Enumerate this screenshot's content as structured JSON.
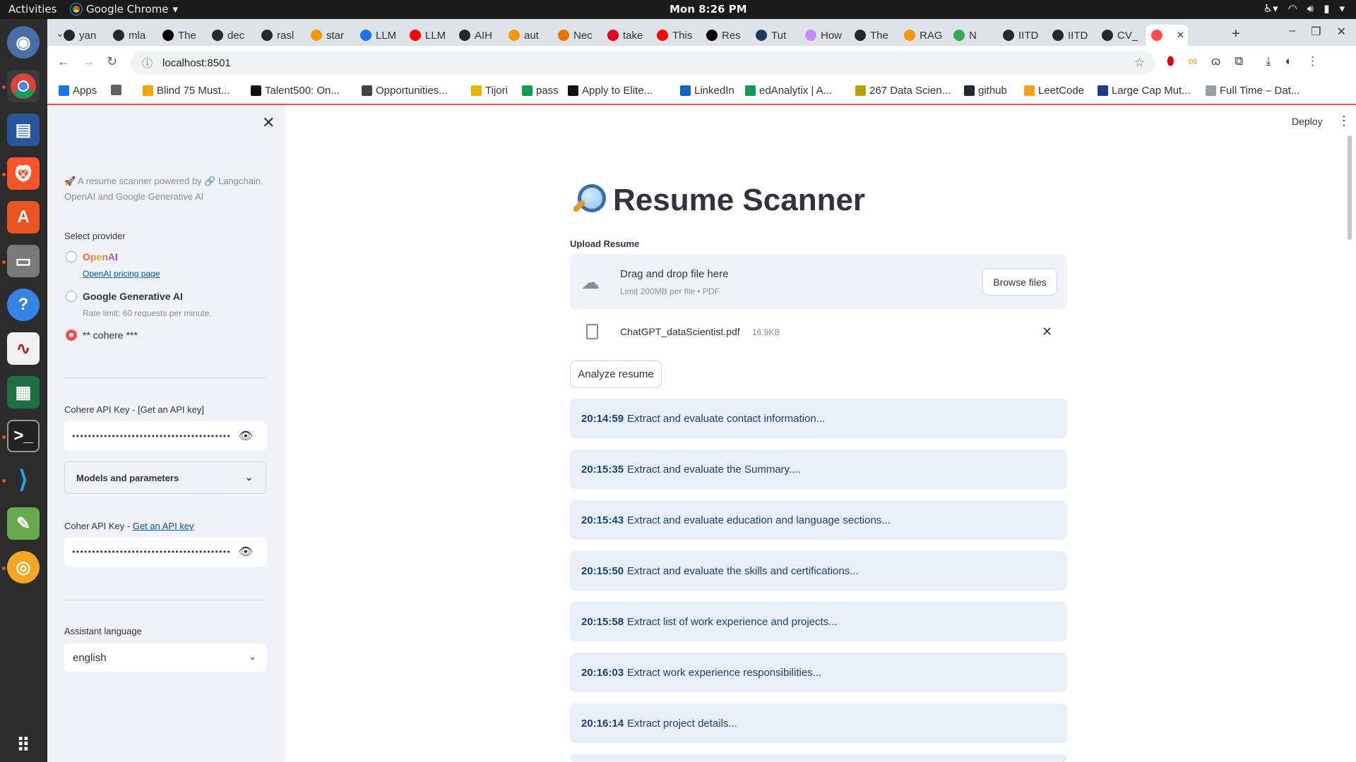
{
  "os": {
    "activities": "Activities",
    "app_name": "Google Chrome",
    "clock": "Mon  8:26 PM"
  },
  "browser": {
    "tabs": [
      {
        "label": "yan",
        "color": "#24292f"
      },
      {
        "label": "mla",
        "color": "#24292f"
      },
      {
        "label": "The",
        "color": "#000000"
      },
      {
        "label": "dec",
        "color": "#24292f"
      },
      {
        "label": "rasl",
        "color": "#24292f"
      },
      {
        "label": "star",
        "color": "#f29900"
      },
      {
        "label": "LLM",
        "color": "#1a73e8"
      },
      {
        "label": "LLM",
        "color": "#ff0000"
      },
      {
        "label": "AIH",
        "color": "#24292f"
      },
      {
        "label": "aut",
        "color": "#f29900"
      },
      {
        "label": "Nec",
        "color": "#e37400"
      },
      {
        "label": "take",
        "color": "#e8001c"
      },
      {
        "label": "This",
        "color": "#ff0000"
      },
      {
        "label": "Res",
        "color": "#000000"
      },
      {
        "label": "Tut",
        "color": "#1e3a5f"
      },
      {
        "label": "How",
        "color": "#c58af9"
      },
      {
        "label": "The",
        "color": "#24292f"
      },
      {
        "label": "RAG",
        "color": "#f29900"
      },
      {
        "label": "N",
        "color": "#34a853"
      },
      {
        "label": "IITD",
        "color": "#24292f"
      },
      {
        "label": "IITD",
        "color": "#24292f"
      },
      {
        "label": "CV_",
        "color": "#24292f"
      },
      {
        "label": "",
        "color": "#ff4b4b"
      }
    ],
    "url": "localhost:8501",
    "bookmarks": [
      {
        "label": "Apps",
        "color": "#1a73e8"
      },
      {
        "label": "",
        "color": "#5f6368"
      },
      {
        "label": "Blind 75 Must...",
        "color": "#f0a500"
      },
      {
        "label": "Talent500: On...",
        "color": "#111111"
      },
      {
        "label": "Opportunities...",
        "color": "#444444"
      },
      {
        "label": "Tijori",
        "color": "#e8b400"
      },
      {
        "label": "pass",
        "color": "#0f9d58"
      },
      {
        "label": "Apply to Elite...",
        "color": "#111111"
      },
      {
        "label": "LinkedIn",
        "color": "#0a66c2"
      },
      {
        "label": "edAnalytix | A...",
        "color": "#0f9d58"
      },
      {
        "label": "267 Data Scien...",
        "color": "#b5a300"
      },
      {
        "label": "github",
        "color": "#24292f"
      },
      {
        "label": "LeetCode",
        "color": "#f89f1b"
      },
      {
        "label": "Large Cap Mut...",
        "color": "#1e3a8a"
      },
      {
        "label": "Full Time – Dat...",
        "color": "#9aa0a6"
      }
    ]
  },
  "sidebar": {
    "caption": "🚀 A resume scanner powered by 🔗 Langchain, OpenAI and Google Generative AI",
    "select_provider_label": "Select provider",
    "providers": [
      {
        "label": "OpenAI",
        "link": "OpenAI pricing page",
        "selected": false
      },
      {
        "label": "Google Generative AI",
        "sub": "Rate limit: 60 requests per minute.",
        "selected": false
      },
      {
        "label": "** cohere ***",
        "selected": true
      }
    ],
    "cohere_key_label": "Cohere API Key - [Get an API key]",
    "cohere_key_value": "••••••••••••••••••••••••••••••••••••••••",
    "models_expander": "Models and parameters",
    "coher_key_label_prefix": "Coher API Key - ",
    "coher_key_link": "Get an API key",
    "coher_key_value": "••••••••••••••••••••••••••••••••••••••••",
    "language_label": "Assistant language",
    "language_value": "english"
  },
  "main": {
    "deploy": "Deploy",
    "title": "Resume Scanner",
    "upload_label": "Upload Resume",
    "drop_title": "Drag and drop file here",
    "drop_sub": "Limit 200MB per file • PDF",
    "browse": "Browse files",
    "file_name": "ChatGPT_dataScientist.pdf",
    "file_size": "16.9KB",
    "analyze": "Analyze resume",
    "steps": [
      {
        "time": "20:14:59",
        "text": "Extract and evaluate contact information..."
      },
      {
        "time": "20:15:35",
        "text": "Extract and evaluate the Summary...."
      },
      {
        "time": "20:15:43",
        "text": "Extract and evaluate education and language sections..."
      },
      {
        "time": "20:15:50",
        "text": "Extract and evaluate the skills and certifications..."
      },
      {
        "time": "20:15:58",
        "text": "Extract list of work experience and projects..."
      },
      {
        "time": "20:16:03",
        "text": "Extract work experience responsibilities..."
      },
      {
        "time": "20:16:14",
        "text": "Extract project details..."
      }
    ]
  }
}
